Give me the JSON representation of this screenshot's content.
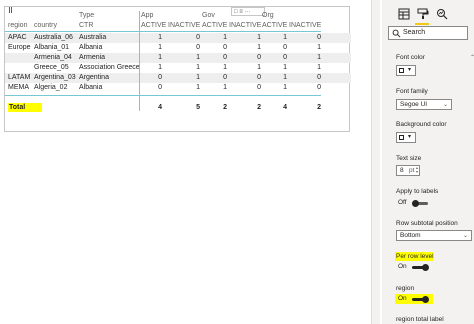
{
  "matrix": {
    "header_options_glyph": "□ ≡ ···",
    "col_headers": {
      "region": "region",
      "country": "country",
      "type": "Type",
      "ctr": "CTR",
      "groups": [
        "App",
        "Gov",
        "Org"
      ],
      "active": "ACTIVE",
      "inactive": "INACTIVE"
    },
    "rows": [
      {
        "region": "APAC",
        "country": "Australia_06",
        "type": "Australia",
        "vals": [
          "1",
          "0",
          "1",
          "1",
          "1",
          "0"
        ]
      },
      {
        "region": "Europe",
        "country": "Albania_01",
        "type": "Albania",
        "vals": [
          "1",
          "0",
          "0",
          "1",
          "0",
          "1"
        ]
      },
      {
        "region": "",
        "country": "Armenia_04",
        "type": "Armenia",
        "vals": [
          "1",
          "1",
          "0",
          "0",
          "0",
          "1"
        ]
      },
      {
        "region": "",
        "country": "Greece_05",
        "type": "Association Greece",
        "vals": [
          "1",
          "1",
          "1",
          "1",
          "1",
          "1"
        ]
      },
      {
        "region": "LATAM",
        "country": "Argentina_03",
        "type": "Argentina",
        "vals": [
          "0",
          "1",
          "0",
          "0",
          "1",
          "0"
        ]
      },
      {
        "region": "MEMA",
        "country": "Algeria_02",
        "type": "Albania",
        "vals": [
          "0",
          "1",
          "1",
          "0",
          "1",
          "0"
        ]
      }
    ],
    "total": {
      "label": "Total",
      "vals": [
        "4",
        "5",
        "2",
        "2",
        "4",
        "2"
      ]
    }
  },
  "panel": {
    "search_placeholder": "Search",
    "font_color_label": "Font color",
    "font_family_label": "Font family",
    "font_family_value": "Segoe UI",
    "background_color_label": "Background color",
    "text_size_label": "Text size",
    "text_size_value": "8",
    "text_size_unit": "pt",
    "apply_to_labels_label": "Apply to labels",
    "apply_to_labels_state": "Off",
    "row_subtotal_position_label": "Row subtotal position",
    "row_subtotal_position_value": "Bottom",
    "per_row_level_label": "Per row level",
    "per_row_level_state": "On",
    "region_label": "region",
    "region_state": "On",
    "region_total_label": "region total label"
  },
  "colors": {
    "highlight": "#ffff00",
    "accent_tab": "#f2c811",
    "separator": "#79c6d6"
  },
  "icons": [
    "table-fields-icon",
    "paint-roller-icon",
    "magnifier-analytics-icon",
    "search-icon",
    "chevron-down-icon"
  ]
}
